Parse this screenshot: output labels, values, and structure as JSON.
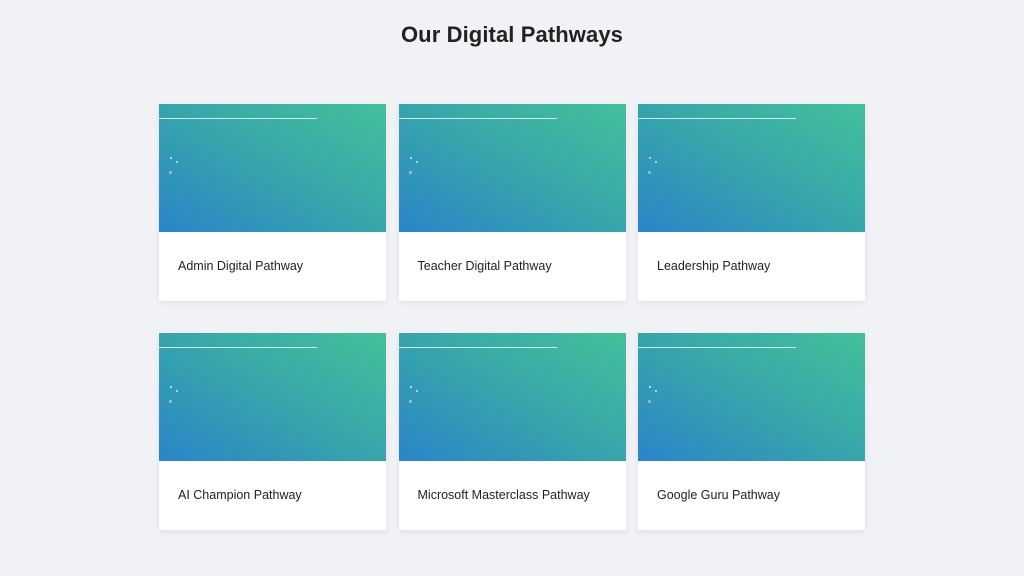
{
  "page": {
    "title": "Our Digital Pathways"
  },
  "theme": {
    "background": "#f1f2f6",
    "gradient_start": "#43c09a",
    "gradient_end": "#2a85c9",
    "card_background": "#ffffff",
    "text_color": "#222222"
  },
  "cards": [
    {
      "label": "Admin Digital Pathway"
    },
    {
      "label": "Teacher Digital Pathway"
    },
    {
      "label": "Leadership Pathway"
    },
    {
      "label": "AI Champion Pathway"
    },
    {
      "label": "Microsoft Masterclass Pathway"
    },
    {
      "label": "Google Guru Pathway"
    }
  ]
}
